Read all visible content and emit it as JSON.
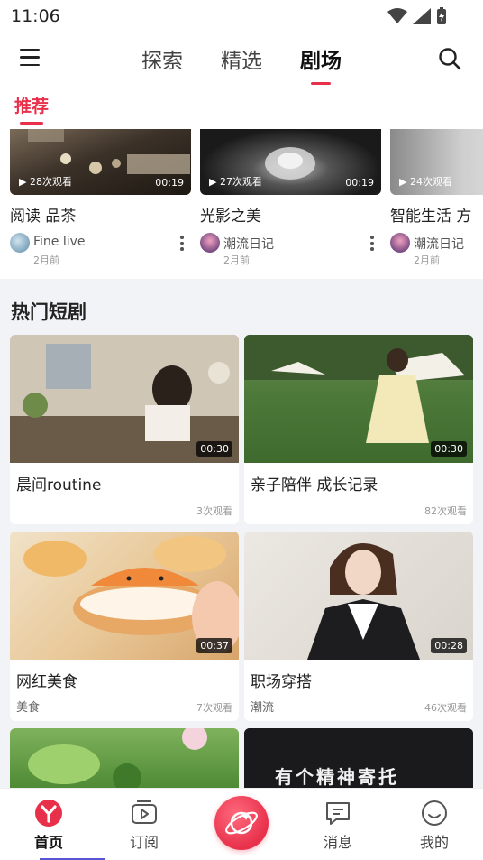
{
  "status_bar": {
    "time": "11:06"
  },
  "header": {
    "tabs": [
      {
        "label": "探索",
        "active": false
      },
      {
        "label": "精选",
        "active": false
      },
      {
        "label": "剧场",
        "active": true
      }
    ]
  },
  "subtab": {
    "label": "推荐"
  },
  "top_videos": [
    {
      "views": "▶ 28次观看",
      "duration": "00:19",
      "title": "阅读 品茶",
      "author": "Fine live",
      "time": "2月前"
    },
    {
      "views": "▶ 27次观看",
      "duration": "00:19",
      "title": "光影之美",
      "author": "潮流日记",
      "time": "2月前"
    },
    {
      "views": "▶ 24次观看",
      "duration": "",
      "title": "智能生活 方",
      "author": "潮流日记",
      "time": "2月前"
    }
  ],
  "section": {
    "title": "热门短剧"
  },
  "grid_videos": [
    {
      "duration": "00:30",
      "title": "晨间routine",
      "tag": "",
      "views": "3次观看"
    },
    {
      "duration": "00:30",
      "title": "亲子陪伴 成长记录",
      "tag": "",
      "views": "82次观看"
    },
    {
      "duration": "00:37",
      "title": "网红美食",
      "tag": "美食",
      "views": "7次观看"
    },
    {
      "duration": "00:28",
      "title": "职场穿搭",
      "tag": "潮流",
      "views": "46次观看"
    },
    {
      "duration": "",
      "title": "",
      "tag": "",
      "views": "",
      "overlay": ""
    },
    {
      "duration": "",
      "title": "",
      "tag": "",
      "views": "",
      "overlay": "有个精神寄托"
    }
  ],
  "bottom_nav": {
    "items": [
      {
        "label": "首页",
        "icon": "home-logo-icon",
        "active": true
      },
      {
        "label": "订阅",
        "icon": "subscribe-icon",
        "active": false
      },
      {
        "label": "",
        "icon": "planet-icon",
        "active": false
      },
      {
        "label": "消息",
        "icon": "message-icon",
        "active": false
      },
      {
        "label": "我的",
        "icon": "profile-icon",
        "active": false
      }
    ]
  },
  "colors": {
    "accent": "#e8304b",
    "section_bg": "#f2f3f6"
  }
}
